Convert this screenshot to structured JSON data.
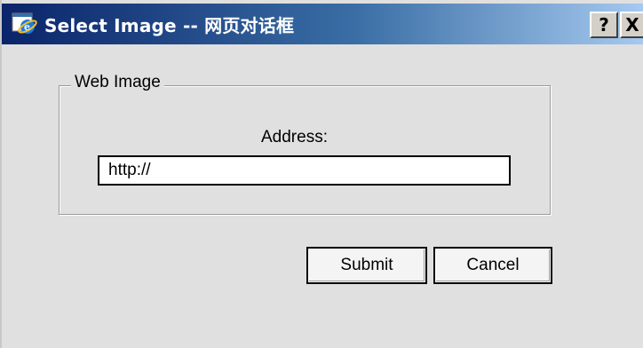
{
  "window": {
    "title": "Select Image -- 网页对话框",
    "help_label": "?",
    "close_label": "X",
    "titlebar_color": "#0a246a",
    "background_color": "#e0e0e0"
  },
  "form": {
    "group_label": "Web Image",
    "address_label": "Address:",
    "address_value": "http://"
  },
  "buttons": {
    "submit_label": "Submit",
    "cancel_label": "Cancel"
  },
  "icons": {
    "app_icon": "internet-explorer-icon"
  }
}
